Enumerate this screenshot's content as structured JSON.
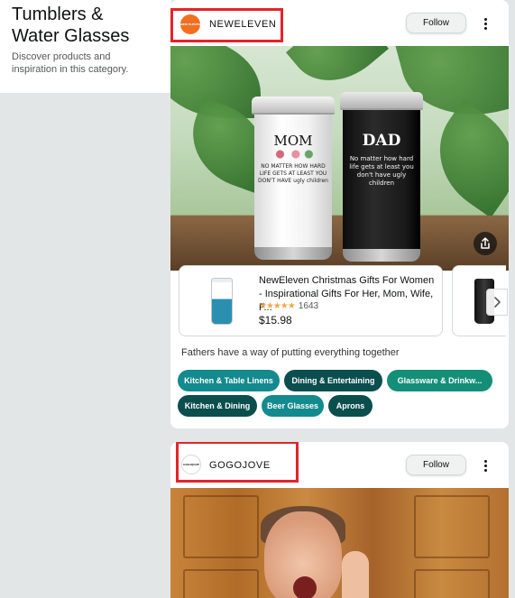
{
  "category": {
    "title_line1": "Tumblers &",
    "title_line2": "Water Glasses",
    "description_line1": "Discover products and",
    "description_line2": "inspiration in this category."
  },
  "posts": [
    {
      "brand": "NEWELEVEN",
      "logo_text": "NEW ELEVEN",
      "follow_label": "Follow",
      "photo": {
        "white_tumbler_title": "MOM",
        "white_tumbler_text": "NO MATTER HOW HARD LIFE GETS AT LEAST YOU DON'T HAVE ugly children",
        "black_tumbler_title": "DAD",
        "black_tumbler_text": "No matter how hard life gets at least you don't have ugly children"
      },
      "product": {
        "title": "NewEleven Christmas Gifts For Women - Inspirational Gifts For Her, Mom, Wife, F...",
        "stars": "★★★★★",
        "rating": 4.8,
        "review_count": "1643",
        "price": "$15.98"
      },
      "caption": "Fathers have a way of putting everything together",
      "tags": [
        {
          "label": "Kitchen & Table Linens",
          "color": "#138a8e"
        },
        {
          "label": "Dining & Entertaining",
          "color": "#0b4e4e"
        },
        {
          "label": "Glassware & Drinkw...",
          "color": "#148f77"
        },
        {
          "label": "Kitchen & Dining",
          "color": "#0b4e4e"
        },
        {
          "label": "Beer Glasses",
          "color": "#138a8e"
        },
        {
          "label": "Aprons",
          "color": "#0b4e4e"
        }
      ]
    },
    {
      "brand": "GOGOJOVE",
      "logo_text": "GOGOJOVE",
      "follow_label": "Follow"
    }
  ],
  "colors": {
    "highlight": "#e3242b",
    "brand_logo_orange": "#f26f21",
    "star": "#f3a847"
  },
  "icons": [
    "more-vertical-icon",
    "share-icon",
    "chevron-right-icon"
  ]
}
